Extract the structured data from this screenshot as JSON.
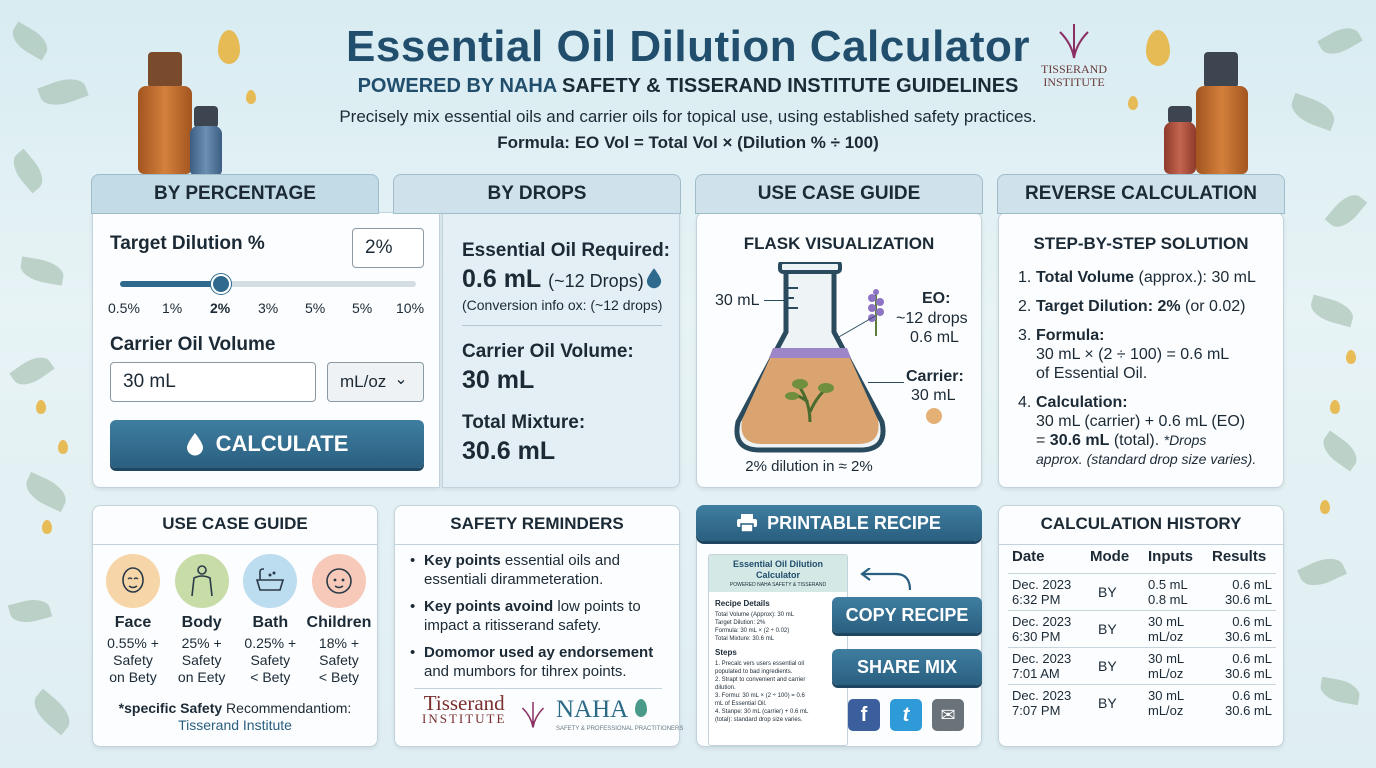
{
  "header": {
    "title": "Essential Oil Dilution Calculator",
    "subtitle_a": "POWERED BY NAHA",
    "subtitle_b": " SAFETY & TISSERAND INSTITUTE GUIDELINES",
    "description": "Precisely mix essential oils and carrier oils for topical use, using established safety practices.",
    "formula": "Formula: EO Vol = Total Vol × (Dilution % ÷ 100)",
    "logo_line1": "TISSERAND",
    "logo_line2": "INSTITUTE"
  },
  "tabs": {
    "by_percentage": "BY PERCENTAGE",
    "by_drops": "BY DROPS",
    "use_case_guide": "USE CASE GUIDE",
    "reverse": "REVERSE CALCULATION"
  },
  "calculator": {
    "target_label": "Target Dilution %",
    "target_value": "2%",
    "slider_level_percent": 2,
    "ticks": [
      "0.5%",
      "1%",
      "2%",
      "3%",
      "5%",
      "5%",
      "10%"
    ],
    "carrier_label": "Carrier Oil Volume",
    "carrier_value": "30 mL",
    "unit_select": "mL/oz",
    "unit_chevron": "⌄",
    "calculate_label": "CALCULATE"
  },
  "results": {
    "eo_label": "Essential Oil Required:",
    "eo_value": "0.6 mL",
    "eo_drops": "(~12 Drops)",
    "conversion": "(Conversion info ox: (~12 drops)",
    "carrier_label": "Carrier Oil Volume:",
    "carrier_value": "30 mL",
    "total_label": "Total Mixture:",
    "total_value": "30.6 mL"
  },
  "flask": {
    "heading": "FLASK VISUALIZATION",
    "volume_label": "30 mL",
    "eo_label": "EO:",
    "eo_drops": "~12 drops",
    "eo_ml": "0.6 mL",
    "carrier_label": "Carrier:",
    "carrier_ml": "30 mL",
    "caption": "2% dilution in ≈ 2%",
    "oil_color": "#d9a46f",
    "eo_color": "#9d86c8"
  },
  "reverse": {
    "heading": "STEP-BY-STEP SOLUTION",
    "s1_num": "1.",
    "s1_bold": "Total Volume",
    "s1_rest": " (approx.): 30 mL",
    "s2_num": "2.",
    "s2_bold": "Target Dilution: 2%",
    "s2_rest": " (or 0.02)",
    "s3_num": "3.",
    "s3_bold": "Formula:",
    "s3_l1": "30 mL × (2 ÷ 100) = 0.6 mL",
    "s3_l2": "of Essential Oil.",
    "s4_num": "4.",
    "s4_bold": "Calculation:",
    "s4_l1": "30 mL (carrier) + 0.6 mL (EO)",
    "s4_eq": "= ",
    "s4_total": "30.6 mL",
    "s4_rest": " (total). ",
    "s4_note1": "*Drops",
    "s4_note2": "approx. (standard drop size varies)."
  },
  "use_cases": {
    "heading": "USE CASE GUIDE",
    "items": [
      {
        "name": "Face",
        "l1": "0.55% +",
        "l2": "Safety",
        "l3": "on Bety",
        "color": "#f6d6a8"
      },
      {
        "name": "Body",
        "l1": "25% +",
        "l2": "Safety",
        "l3": "on Eety",
        "color": "#c8dca8"
      },
      {
        "name": "Bath",
        "l1": "0.25% +",
        "l2": "Safety",
        "l3": "< Bety",
        "color": "#bcdcef"
      },
      {
        "name": "Children",
        "l1": "18% +",
        "l2": "Safety",
        "l3": "< Bety",
        "color": "#f7c9b8"
      }
    ],
    "footnote_a": "*specific Safety",
    "footnote_b": " Recommendantiom:",
    "footnote_link": "Tisserand Institute"
  },
  "safety": {
    "heading": "SAFETY REMINDERS",
    "items": [
      {
        "bold": "Key points",
        "rest": " essential oils and",
        "l2": "essentiali dirammeteration."
      },
      {
        "bold": "Key points avoind",
        "rest": " low points to",
        "l2": "impact a ritisserand safety."
      },
      {
        "bold": "Domomor used ay endorsement",
        "rest": "",
        "l2": "and mumbors for tihrex points."
      }
    ],
    "logo1_l1": "Tisserand",
    "logo1_l2": "INSTITUTE",
    "logo2": "NAHA",
    "logo2_sub": "SAFETY & PROFESSIONAL PRACTITIONERS"
  },
  "recipe": {
    "header_btn": "PRINTABLE RECIPE",
    "preview_title": "Essential Oil Dilution Calculator",
    "preview_sub": "POWERED NAHA SAFETY & TISSERAND",
    "details_heading": "Recipe Details",
    "d1": "Total Volume (Approx): 30 mL",
    "d2": "Target Dilution: 2%",
    "d3": "Formula: 30 mL × (2 ÷ 0.02)",
    "d4": "Total Mixture: 30.6 mL",
    "steps_heading": "Steps",
    "st1": "1. Precalc vers users essential oil",
    "st1b": "populated to bad ingredients.",
    "st2": "2. Strapt to convenient and carrier",
    "st2b": "dilution.",
    "st3": "3. Formu: 30 mL × (2 ÷ 100) = 0.6",
    "st3b": "mL of Essential Oil.",
    "st4": "4. Stanpe: 30 mL (carrier) + 0.6 mL",
    "st4b": "(total): standard drop size varies.",
    "copy_label": "COPY RECIPE",
    "share_label": "SHARE MIX",
    "fb": "f",
    "tw": "t",
    "mail": "✉"
  },
  "history": {
    "heading": "CALCULATION HISTORY",
    "columns": [
      "Date",
      "Mode",
      "Inputs",
      "Results"
    ],
    "rows": [
      {
        "date": "Dec. 2023",
        "time": "6:32 PM",
        "mode": "BY",
        "in1": "0.5 mL",
        "in2": "0.8 mL",
        "r1": "0.6 mL",
        "r2": "30.6 mL"
      },
      {
        "date": "Dec. 2023",
        "time": "6:30 PM",
        "mode": "BY",
        "in1": "30 mL",
        "in2": "mL/oz",
        "r1": "0.6 mL",
        "r2": "30.6 mL"
      },
      {
        "date": "Dec. 2023",
        "time": "7:01 AM",
        "mode": "BY",
        "in1": "30 mL",
        "in2": "mL/oz",
        "r1": "0.6 mL",
        "r2": "30.6 mL"
      },
      {
        "date": "Dec. 2023",
        "time": "7:07 PM",
        "mode": "BY",
        "in1": "30 mL",
        "in2": "mL/oz",
        "r1": "0.6 mL",
        "r2": "30.6 mL"
      }
    ]
  },
  "colors": {
    "accent": "#2f6a8e",
    "title": "#214e6c",
    "tab": "#cfe2ec"
  }
}
